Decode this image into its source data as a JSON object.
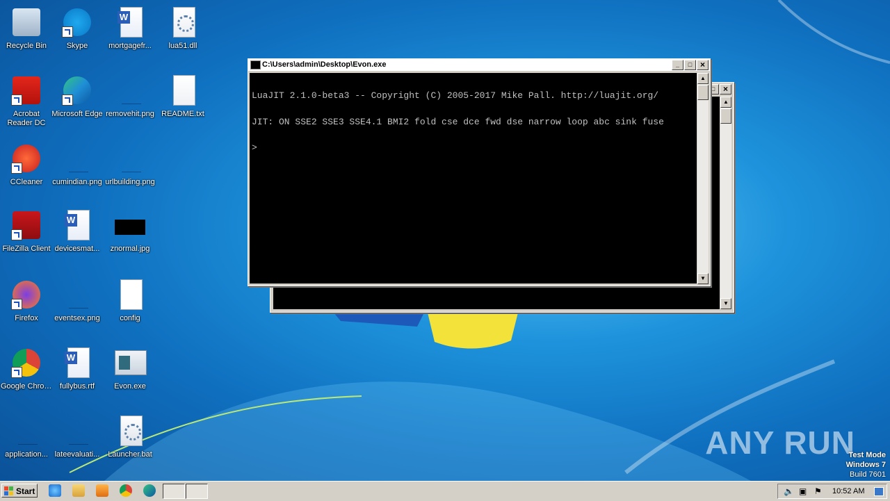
{
  "desktop": {
    "icons": [
      {
        "label": "Recycle Bin",
        "icon": "recycle-bin-icon"
      },
      {
        "label": "Skype",
        "icon": "skype-icon"
      },
      {
        "label": "mortgagefr...",
        "icon": "word-doc-icon"
      },
      {
        "label": "lua51.dll",
        "icon": "dll-gear-icon"
      },
      {
        "label": "Acrobat Reader DC",
        "icon": "acrobat-icon"
      },
      {
        "label": "Microsoft Edge",
        "icon": "edge-icon"
      },
      {
        "label": "removehit.png",
        "icon": "png-thumb-icon"
      },
      {
        "label": "README.txt",
        "icon": "text-file-icon"
      },
      {
        "label": "CCleaner",
        "icon": "ccleaner-icon"
      },
      {
        "label": "cumindian.png",
        "icon": "png-thumb-icon"
      },
      {
        "label": "urlbuilding.png",
        "icon": "png-thumb-icon"
      },
      {
        "label": "FileZilla Client",
        "icon": "filezilla-icon"
      },
      {
        "label": "devicesmat...",
        "icon": "word-doc-icon"
      },
      {
        "label": "znormal.jpg",
        "icon": "jpg-thumb-icon"
      },
      {
        "label": "Firefox",
        "icon": "firefox-icon"
      },
      {
        "label": "eventsex.png",
        "icon": "png-thumb-icon"
      },
      {
        "label": "config",
        "icon": "blank-file-icon"
      },
      {
        "label": "Google Chrome",
        "icon": "chrome-icon"
      },
      {
        "label": "fullybus.rtf",
        "icon": "word-doc-icon"
      },
      {
        "label": "Evon.exe",
        "icon": "exe-window-icon"
      },
      {
        "label": "application...",
        "icon": "png-thumb-icon"
      },
      {
        "label": "lateevaluati...",
        "icon": "png-thumb-icon"
      },
      {
        "label": "Launcher.bat",
        "icon": "bat-gear-icon"
      }
    ]
  },
  "console_window": {
    "title": "C:\\Users\\admin\\Desktop\\Evon.exe",
    "lines": [
      "LuaJIT 2.1.0-beta3 -- Copyright (C) 2005-2017 Mike Pall. http://luajit.org/",
      "JIT: ON SSE2 SSE3 SSE4.1 BMI2 fold cse dce fwd dse narrow loop abc sink fuse",
      ">"
    ],
    "buttons": {
      "minimize": "_",
      "maximize": "□",
      "close": "×"
    }
  },
  "background_window": {
    "close": "×",
    "restore": "□"
  },
  "taskbar": {
    "start_label": "Start",
    "clock": "10:52 AM"
  },
  "watermark": "ANY RUN",
  "test_mode": {
    "line1": "Test Mode",
    "line2": "Windows 7",
    "line3": "Build 7601"
  }
}
